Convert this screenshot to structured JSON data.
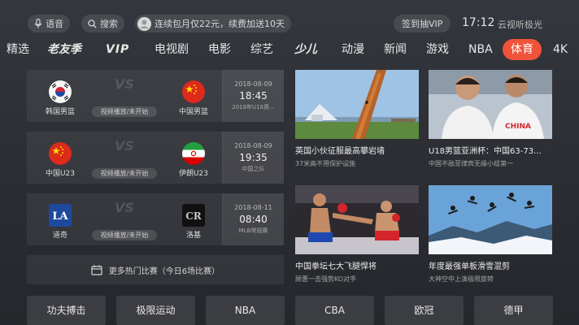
{
  "topbar": {
    "voice_label": "语音",
    "search_label": "搜索",
    "promo_text": "连续包月仅22元，续费加送10天",
    "vip_sign_label": "签到抽VIP",
    "time": "17:12",
    "brand": "云视听极光"
  },
  "nav": {
    "items": [
      {
        "label": "精选"
      },
      {
        "label": "老友季"
      },
      {
        "label": "VIP"
      },
      {
        "label": "电视剧"
      },
      {
        "label": "电影"
      },
      {
        "label": "综艺"
      },
      {
        "label": "少儿"
      },
      {
        "label": "动漫"
      },
      {
        "label": "新闻"
      },
      {
        "label": "游戏"
      },
      {
        "label": "NBA"
      },
      {
        "label": "体育"
      },
      {
        "label": "4K"
      }
    ]
  },
  "matches": [
    {
      "home": "韩国男篮",
      "away": "中国男篮",
      "vs": "VS",
      "status": "视频播放/未开始",
      "date": "2018-08-09",
      "time": "18:45",
      "league": "2018年U18男..."
    },
    {
      "home": "中国U23",
      "away": "伊朗U23",
      "vs": "VS",
      "status": "视频播放/未开始",
      "date": "2018-08-09",
      "time": "19:35",
      "league": "中国之队"
    },
    {
      "home": "道奇",
      "away": "洛基",
      "vs": "VS",
      "status": "视频播放/未开始",
      "date": "2018-08-11",
      "time": "08:40",
      "league": "MLB常规赛"
    }
  ],
  "more_matches": "更多热门比赛（今日6场比赛）",
  "videos": [
    {
      "title": "英国小伙征服最高攀岩墙",
      "subtitle": "37米高不用保护设施"
    },
    {
      "title": "U18男篮亚洲杯：中国63-73...",
      "subtitle": "中国不敌菲律宾无缘小组第一"
    },
    {
      "title": "中国拳坛七大飞腿悍将",
      "subtitle": "顾惠一击强势KO对手"
    },
    {
      "title": "年度最强单板滑雪混剪",
      "subtitle": "大神空中上演极限旋转"
    }
  ],
  "categories": [
    {
      "label": "功夫搏击"
    },
    {
      "label": "极限运动"
    },
    {
      "label": "NBA"
    },
    {
      "label": "CBA"
    },
    {
      "label": "欧冠"
    },
    {
      "label": "德甲"
    }
  ],
  "colors": {
    "accent": "#f0533a",
    "background": "#2e3036"
  }
}
